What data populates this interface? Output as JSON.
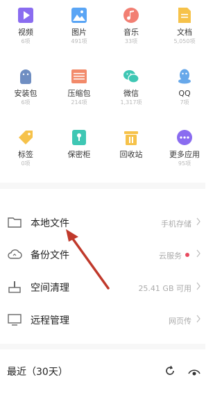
{
  "categories": [
    {
      "label": "视频",
      "count": "6项",
      "icon": "video-icon",
      "color": "#8a6cf0"
    },
    {
      "label": "图片",
      "count": "491项",
      "icon": "image-icon",
      "color": "#5aa5f5"
    },
    {
      "label": "音乐",
      "count": "33项",
      "icon": "music-icon",
      "color": "#f27f73"
    },
    {
      "label": "文档",
      "count": "5,050项",
      "icon": "document-icon",
      "color": "#f6c24a"
    },
    {
      "label": "安装包",
      "count": "6项",
      "icon": "android-icon",
      "color": "#6f8ec2"
    },
    {
      "label": "压缩包",
      "count": "214项",
      "icon": "zip-icon",
      "color": "#f28a6a"
    },
    {
      "label": "微信",
      "count": "1,317项",
      "icon": "wechat-icon",
      "color": "#3fc7b4"
    },
    {
      "label": "QQ",
      "count": "7项",
      "icon": "qq-icon",
      "color": "#67a8ea"
    },
    {
      "label": "标签",
      "count": "0项",
      "icon": "tag-icon",
      "color": "#f6c24a"
    },
    {
      "label": "保密柜",
      "count": "",
      "icon": "safe-icon",
      "color": "#3fc7b4"
    },
    {
      "label": "回收站",
      "count": "",
      "icon": "trash-icon",
      "color": "#f6c24a"
    },
    {
      "label": "更多应用",
      "count": "95项",
      "icon": "more-icon",
      "color": "#8a6cf0"
    }
  ],
  "rows": [
    {
      "label": "本地文件",
      "value": "手机存储",
      "icon": "folder-icon"
    },
    {
      "label": "备份文件",
      "value": "云服务",
      "icon": "cloud-icon",
      "dot": "#e84a5f"
    },
    {
      "label": "空间清理",
      "value": "25.41 GB 可用",
      "icon": "broom-icon"
    },
    {
      "label": "远程管理",
      "value": "网页传",
      "icon": "monitor-icon"
    }
  ],
  "recent": {
    "title": "最近（30天）"
  },
  "colors": {
    "arrow": "#c0392b",
    "divider": "#f7f7f7"
  }
}
